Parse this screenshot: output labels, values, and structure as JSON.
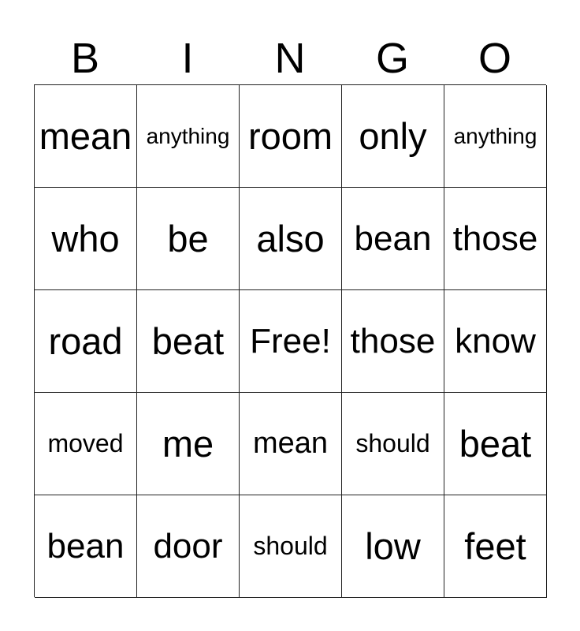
{
  "header": [
    "B",
    "I",
    "N",
    "G",
    "O"
  ],
  "cells": [
    [
      "mean",
      "anything",
      "room",
      "only",
      "anything"
    ],
    [
      "who",
      "be",
      "also",
      "bean",
      "those"
    ],
    [
      "road",
      "beat",
      "Free!",
      "those",
      "know"
    ],
    [
      "moved",
      "me",
      "mean",
      "should",
      "beat"
    ],
    [
      "bean",
      "door",
      "should",
      "low",
      "feet"
    ]
  ]
}
